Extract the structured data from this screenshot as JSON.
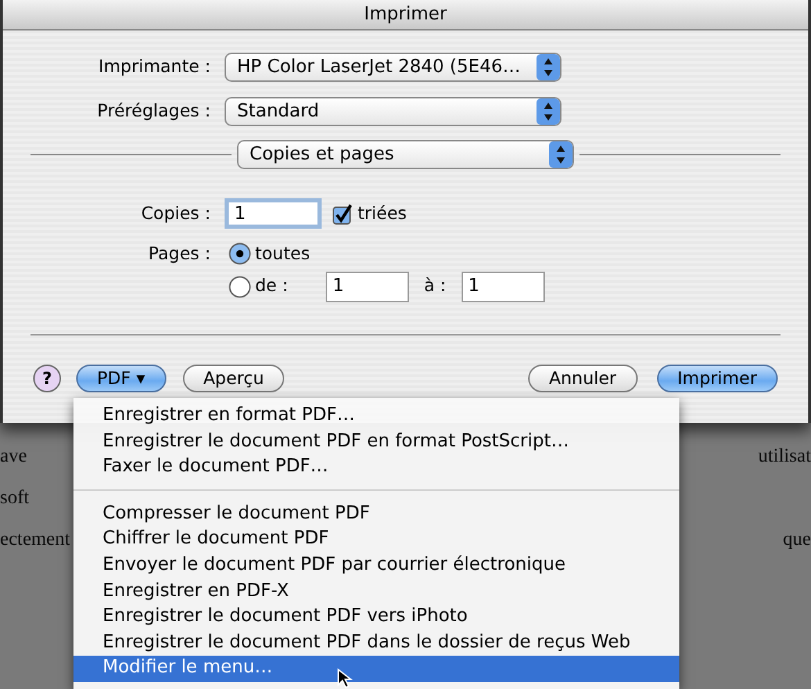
{
  "window": {
    "title": "Imprimer"
  },
  "popups": [
    {
      "label": "Imprimante :",
      "value": "HP Color LaserJet 2840 (5E46…"
    },
    {
      "label": "Préréglages :",
      "value": "Standard"
    }
  ],
  "panel_popup": {
    "value": "Copies et pages"
  },
  "copies": {
    "label": "Copies :",
    "value": "1"
  },
  "collated": {
    "label": "triées",
    "checked": true
  },
  "pages": {
    "label": "Pages :",
    "options": [
      {
        "label": "toutes",
        "selected": true
      },
      {
        "label": "de :",
        "selected": false
      }
    ],
    "from": "1",
    "to_label": "à :",
    "to": "1"
  },
  "help_button": "?",
  "buttons": [
    {
      "label": "PDF ▾",
      "kind": "pdf"
    },
    {
      "label": "Aperçu",
      "kind": "plain"
    },
    {
      "label": "Annuler",
      "kind": "plain"
    },
    {
      "label": "Imprimer",
      "kind": "default"
    }
  ],
  "pdf_menu": [
    {
      "kind": "item",
      "label": "Enregistrer en format PDF…",
      "selected": false
    },
    {
      "kind": "item",
      "label": "Enregistrer le document PDF en format PostScript…",
      "selected": false
    },
    {
      "kind": "item",
      "label": "Faxer le document PDF…",
      "selected": false
    },
    {
      "kind": "separator"
    },
    {
      "kind": "item",
      "label": "Compresser le document PDF",
      "selected": false
    },
    {
      "kind": "item",
      "label": "Chiffrer le document PDF",
      "selected": false
    },
    {
      "kind": "item",
      "label": "Envoyer le document PDF par courrier électronique",
      "selected": false
    },
    {
      "kind": "item",
      "label": "Enregistrer en PDF-X",
      "selected": false
    },
    {
      "kind": "item",
      "label": "Enregistrer le document PDF vers iPhoto",
      "selected": false
    },
    {
      "kind": "item",
      "label": "Enregistrer le document PDF dans le dossier de reçus Web",
      "selected": false
    },
    {
      "kind": "item",
      "label": "Modifier le menu…",
      "selected": true
    }
  ],
  "background_text": [
    {
      "left": "ave",
      "right": "utilisat"
    },
    {
      "left": "soft"
    },
    {
      "left": "ectement",
      "right": "que"
    }
  ]
}
